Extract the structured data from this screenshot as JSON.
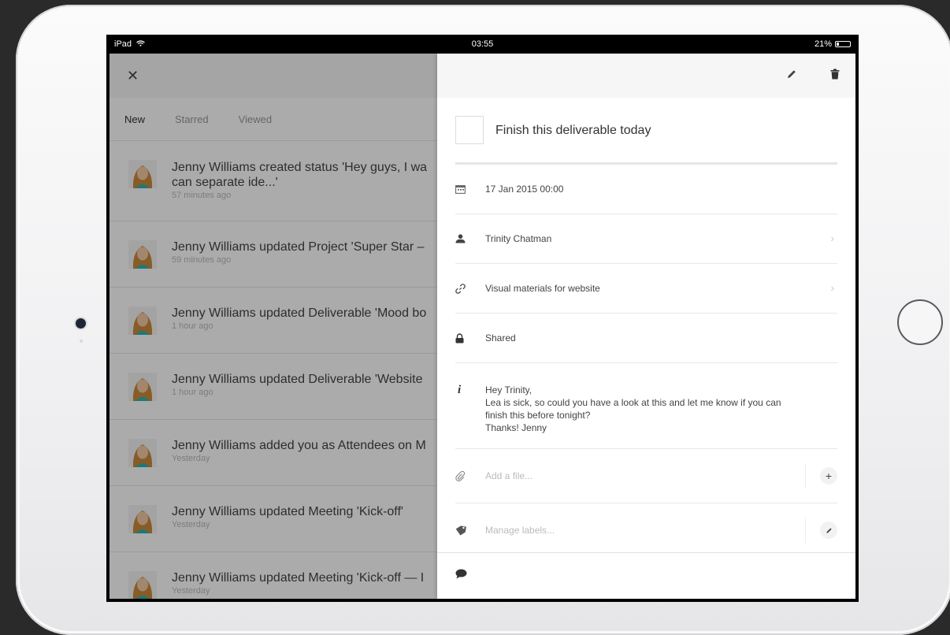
{
  "status_bar": {
    "device": "iPad",
    "time": "03:55",
    "battery": "21%",
    "battery_level": 0.21
  },
  "feed": {
    "tabs": [
      {
        "label": "New",
        "active": true
      },
      {
        "label": "Starred",
        "active": false
      },
      {
        "label": "Viewed",
        "active": false
      }
    ],
    "items": [
      {
        "title": "Jenny Williams created status 'Hey guys, I wa can separate ide...'",
        "line1": "Jenny Williams created status 'Hey guys, I wa",
        "line2": "can separate ide...'",
        "time": "57 minutes ago"
      },
      {
        "title": "Jenny Williams updated Project 'Super Star –",
        "time": "59 minutes ago"
      },
      {
        "title": "Jenny Williams updated Deliverable 'Mood bo",
        "time": "1 hour ago"
      },
      {
        "title": "Jenny Williams updated Deliverable 'Website",
        "time": "1 hour ago"
      },
      {
        "title": "Jenny Williams added you as Attendees on M",
        "time": "Yesterday"
      },
      {
        "title": "Jenny Williams updated Meeting 'Kick-off'",
        "time": "Yesterday"
      },
      {
        "title": "Jenny Williams updated Meeting 'Kick-off — I",
        "time": "Yesterday"
      }
    ]
  },
  "detail": {
    "title": "Finish this deliverable today",
    "date": "17 Jan 2015 00:00",
    "assignee": "Trinity Chatman",
    "project": "Visual materials for website",
    "visibility": "Shared",
    "note_lines": [
      "Hey Trinity,",
      "Lea is sick, so could you have a look at this and let me know if you can",
      "finish this before tonight?",
      "Thanks! Jenny"
    ],
    "add_file_placeholder": "Add a file...",
    "manage_labels_placeholder": "Manage labels..."
  },
  "colors": {
    "overlay": "#00000055",
    "divider": "#e8e8e8",
    "text_dark": "#333333",
    "text_muted": "#bbbbbb"
  }
}
